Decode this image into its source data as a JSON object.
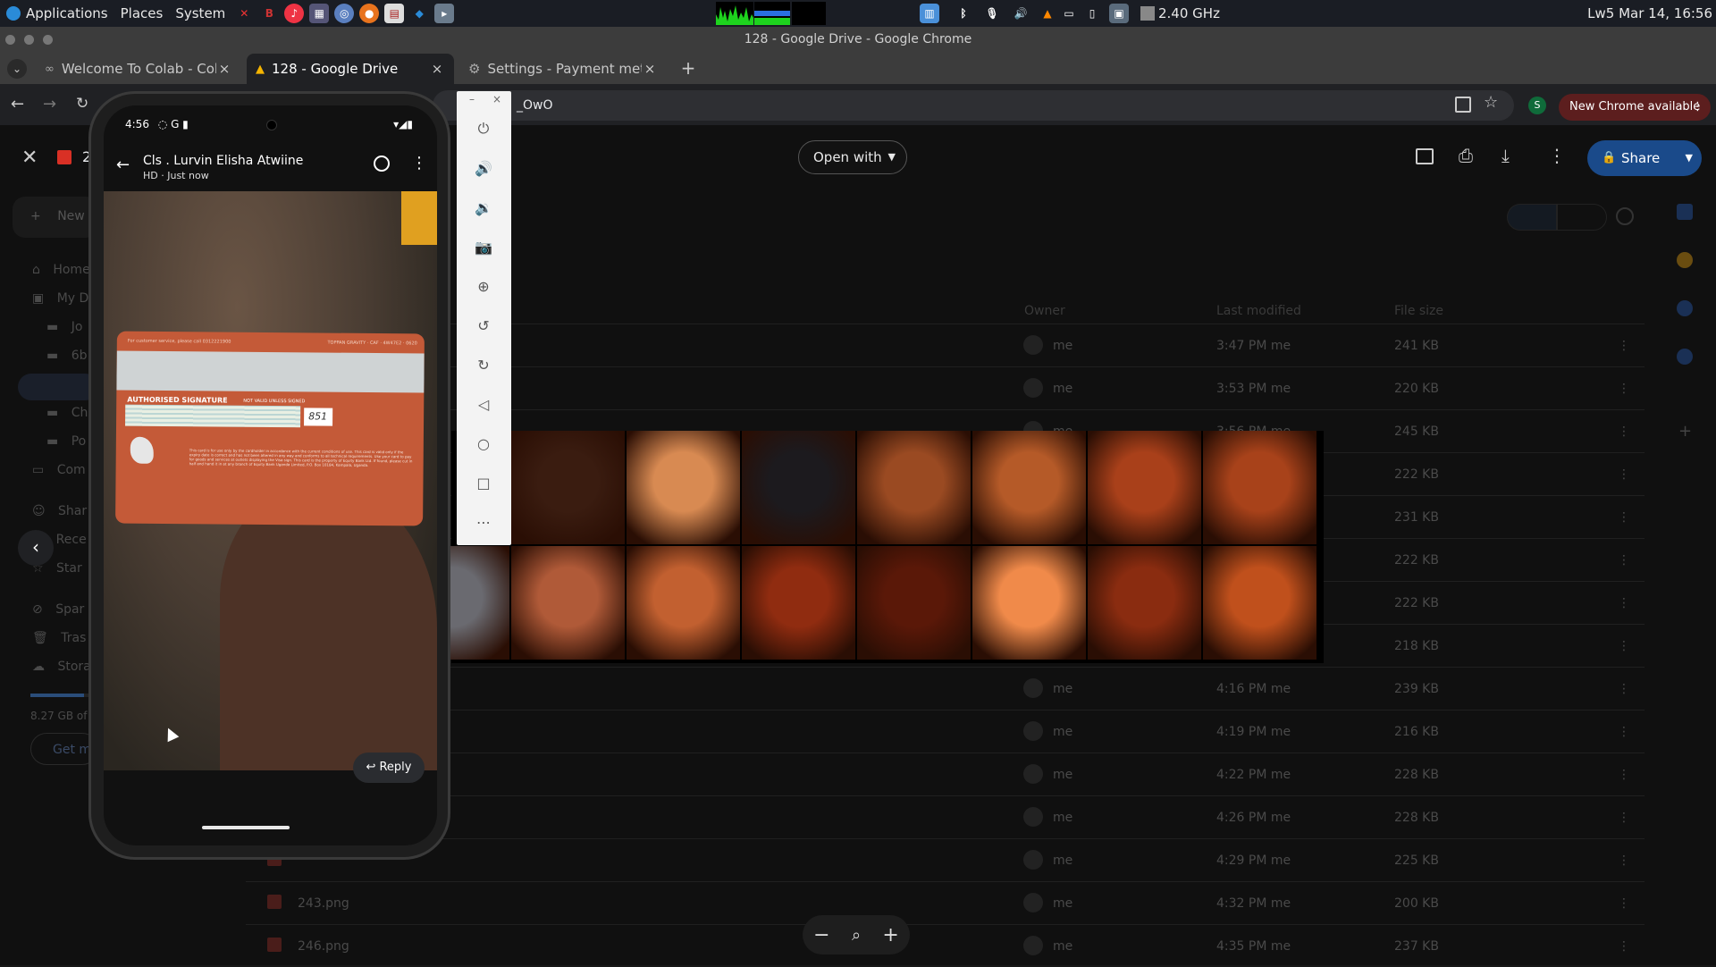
{
  "panel": {
    "applications": "Applications",
    "places": "Places",
    "system": "System",
    "cpu_freq": "2.40 GHz",
    "clock": "Lw5 Mar 14, 16:56"
  },
  "window": {
    "title": "128 - Google Drive - Google Chrome"
  },
  "tabs": [
    {
      "label": "Welcome To Colab - Cola"
    },
    {
      "label": "128 - Google Drive"
    },
    {
      "label": "Settings - Payment meth"
    }
  ],
  "omnibox": {
    "url": "_OwO"
  },
  "chrome": {
    "profile_initial": "S",
    "update_label": "New Chrome available"
  },
  "drive": {
    "file_count_label": "2",
    "open_with": "Open with",
    "share": "Share",
    "sidebar": [
      "New",
      "Home",
      "My D",
      "Jo",
      "6b",
      "Ch",
      "Po",
      "Com",
      "Shar",
      "Rece",
      "Star",
      "Spar",
      "Tras",
      "Stora"
    ],
    "storage_text": "8.27 GB of",
    "get_more": "Get m",
    "columns": {
      "owner": "Owner",
      "last_modified": "Last modified",
      "file_size": "File size"
    },
    "rows": [
      {
        "name": "",
        "owner": "me",
        "modified": "3:47 PM me",
        "size": "241 KB"
      },
      {
        "name": "",
        "owner": "me",
        "modified": "3:53 PM me",
        "size": "220 KB"
      },
      {
        "name": "",
        "owner": "me",
        "modified": "3:56 PM me",
        "size": "245 KB"
      },
      {
        "name": "",
        "owner": "me",
        "modified": "",
        "size": "222 KB"
      },
      {
        "name": "",
        "owner": "me",
        "modified": "",
        "size": "231 KB"
      },
      {
        "name": "",
        "owner": "me",
        "modified": "",
        "size": "222 KB"
      },
      {
        "name": "",
        "owner": "me",
        "modified": "",
        "size": "222 KB"
      },
      {
        "name": "",
        "owner": "me",
        "modified": "",
        "size": "218 KB"
      },
      {
        "name": "",
        "owner": "me",
        "modified": "4:16 PM me",
        "size": "239 KB"
      },
      {
        "name": "",
        "owner": "me",
        "modified": "4:19 PM me",
        "size": "216 KB"
      },
      {
        "name": "",
        "owner": "me",
        "modified": "4:22 PM me",
        "size": "228 KB"
      },
      {
        "name": "",
        "owner": "me",
        "modified": "4:26 PM me",
        "size": "228 KB"
      },
      {
        "name": "",
        "owner": "me",
        "modified": "4:29 PM me",
        "size": "225 KB"
      },
      {
        "name": "243.png",
        "owner": "me",
        "modified": "4:32 PM me",
        "size": "200 KB"
      },
      {
        "name": "246.png",
        "owner": "me",
        "modified": "4:35 PM me",
        "size": "237 KB"
      }
    ]
  },
  "phone": {
    "status_time": "4:56",
    "contact_name": "Cls . Lurvin Elisha Atwiine",
    "message_meta": "HD · Just now",
    "card_header": "For customer service, please call 0312221900",
    "card_brand": "TOPPAN GRAVITY · CAF · 4W47E2 · 0620",
    "signature_label": "AUTHORISED SIGNATURE",
    "signature_note": "NOT VALID UNLESS SIGNED",
    "cvv": "851",
    "card_terms": "This card is for use only by the cardholder in accordance with the current conditions of use. This card is valid only if the expiry date is correct and has not been altered in any way and conforms to all technical requirements. Use your card to pay for goods and services at outlets displaying the Visa sign. This card is the property of Equity Bank Ltd. If found, please cut in half and hand it in at any branch of Equity Bank Uganda Limited, P.O. Box 10184, Kampala, Uganda.",
    "reply": "Reply"
  },
  "colors": {
    "panel_bg": "#1a1d24",
    "chrome_bg": "#3c3c3c",
    "toolbar_bg": "#202124",
    "share_blue": "#1a4a8a",
    "update_red": "#5c1e1e",
    "card_orange": "#c45a38"
  }
}
